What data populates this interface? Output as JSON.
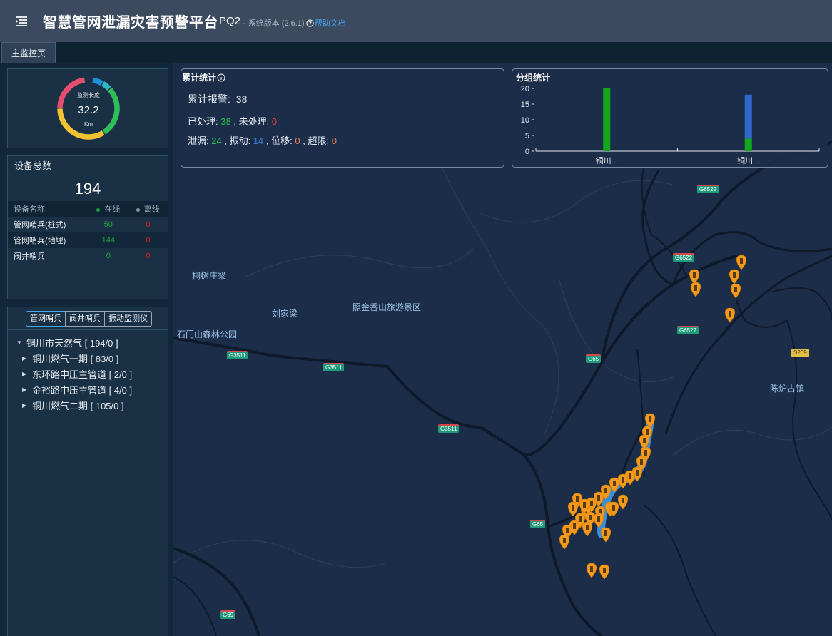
{
  "header": {
    "app_title": "智慧管网泄漏灾害预警平台",
    "app_code": "PQ2",
    "version_label": "- 系统版本 (2.6.1)",
    "help_label": "帮助文档"
  },
  "tabs": [
    {
      "label": "主监控页"
    }
  ],
  "gauge": {
    "label": "监测长度",
    "value": "32.2",
    "unit": "Km",
    "segments": [
      {
        "color": "#1e90d6",
        "fraction": 0.06
      },
      {
        "color": "#2fb8c8",
        "fraction": 0.05
      },
      {
        "color": "#2fbf5a",
        "fraction": 0.28
      },
      {
        "color": "#f1c232",
        "fraction": 0.34
      },
      {
        "color": "#e54e6f",
        "fraction": 0.23
      }
    ]
  },
  "devices": {
    "title": "设备总数",
    "total": "194",
    "headers": {
      "name": "设备名称",
      "online": "在线",
      "offline": "离线"
    },
    "rows": [
      {
        "name": "管网哨兵(桩式)",
        "online": "50",
        "offline": "0"
      },
      {
        "name": "管网哨兵(地埋)",
        "online": "144",
        "offline": "0"
      },
      {
        "name": "阀井哨兵",
        "online": "0",
        "offline": "0"
      }
    ],
    "colors": {
      "online": "#21a53d",
      "offline": "#8f9aa6"
    }
  },
  "tree": {
    "tabs": [
      "管网哨兵",
      "阀井哨兵",
      "振动监测仪"
    ],
    "root": "铜川市天然气 [ 194/0 ]",
    "children": [
      "铜川燃气一期 [ 83/0 ]",
      "东环路中压主管道 [ 2/0 ]",
      "金裕路中压主管道 [ 4/0 ]",
      "铜川燃气二期 [ 105/0 ]"
    ]
  },
  "stats": {
    "title": "累计统计",
    "total_label": "累计报警:",
    "total_value": "38",
    "processed_label": "已处理:",
    "processed_value": "38",
    "unprocessed_label": ", 未处理:",
    "unprocessed_value": "0",
    "leak_label": "泄漏:",
    "leak_value": "24",
    "vibration_label": ", 振动:",
    "vibration_value": "14",
    "displacement_label": ", 位移:",
    "displacement_value": "0",
    "overlimit_label": ", 超限:",
    "overlimit_value": "0"
  },
  "group_stats": {
    "title": "分组统计"
  },
  "chart_data": {
    "type": "bar",
    "stacked": true,
    "categories": [
      "铜川...",
      "铜川..."
    ],
    "series": [
      {
        "color": "#13a81c",
        "values": [
          20,
          4
        ]
      },
      {
        "color": "#2f68c8",
        "values": [
          0,
          14
        ]
      }
    ],
    "yticks": [
      0,
      5,
      10,
      15,
      20
    ],
    "ylim": [
      0,
      20
    ]
  },
  "map": {
    "places": [
      "桐树庄梁",
      "刘家梁",
      "照金香山旅游景区",
      "石门山森林公园",
      "陈炉古镇"
    ],
    "roads": [
      "G3511",
      "G3511",
      "G3511",
      "G65",
      "G65",
      "G6522",
      "G6522",
      "G6522",
      "G69",
      "S209"
    ]
  }
}
